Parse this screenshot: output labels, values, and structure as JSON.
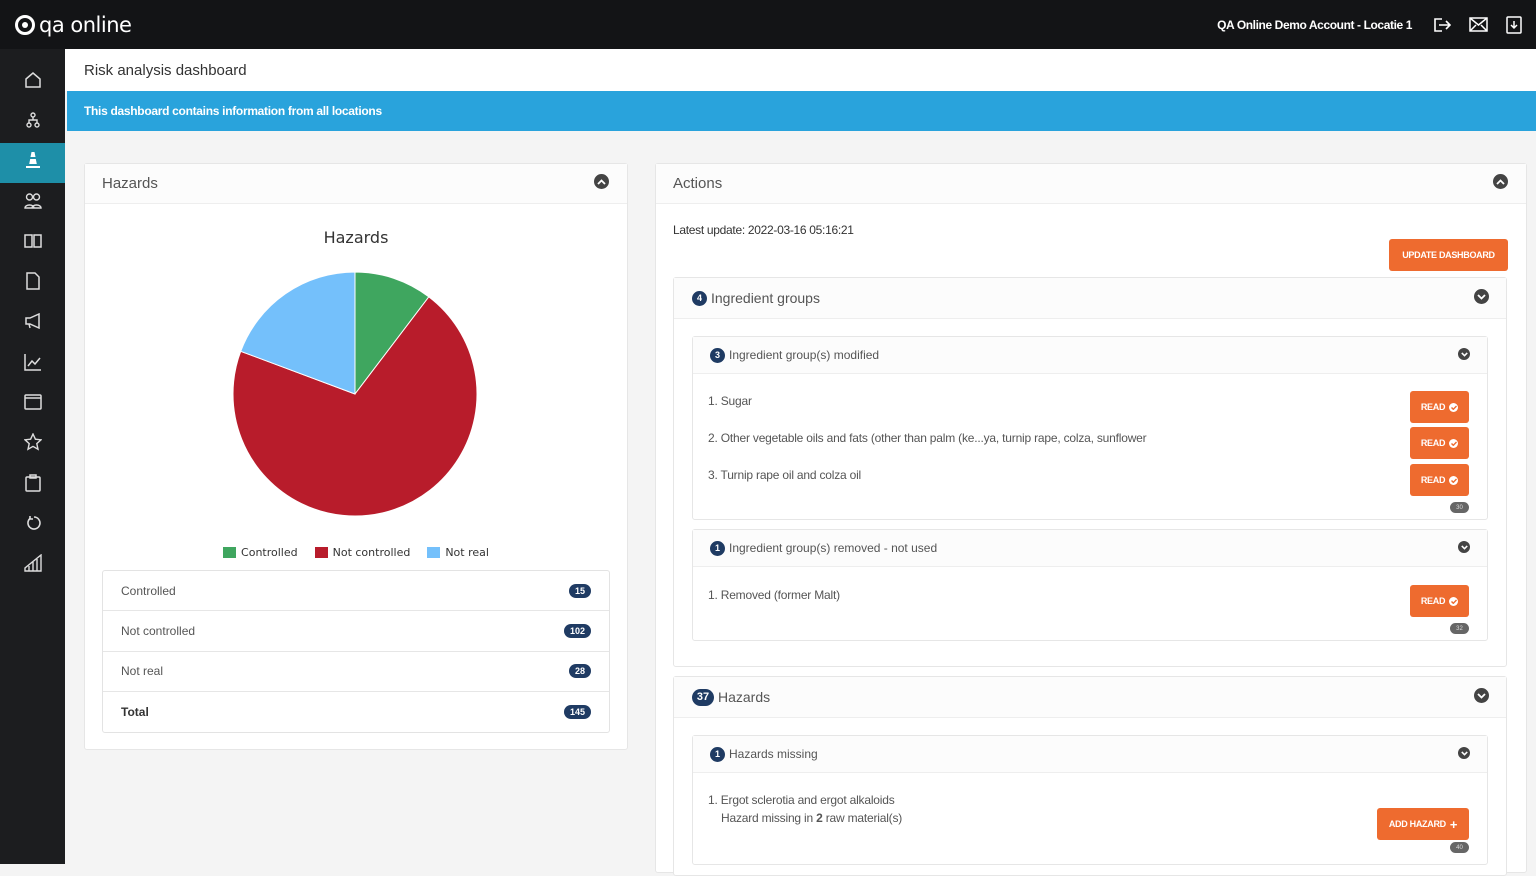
{
  "app": {
    "logo_text": "qa online",
    "account": "QA Online Demo Account - Locatie 1"
  },
  "topbar_icons": [
    "logout-icon",
    "mail-icon",
    "download-icon"
  ],
  "sidebar": {
    "items": [
      {
        "icon": "home-icon",
        "active": false
      },
      {
        "icon": "org-chart-icon",
        "active": false
      },
      {
        "icon": "cone-icon",
        "active": true
      },
      {
        "icon": "users-icon",
        "active": false
      },
      {
        "icon": "book-icon",
        "active": false
      },
      {
        "icon": "document-icon",
        "active": false
      },
      {
        "icon": "megaphone-icon",
        "active": false
      },
      {
        "icon": "chart-line-icon",
        "active": false
      },
      {
        "icon": "window-icon",
        "active": false
      },
      {
        "icon": "star-icon",
        "active": false
      },
      {
        "icon": "clipboard-icon",
        "active": false
      },
      {
        "icon": "refresh-icon",
        "active": false
      },
      {
        "icon": "bar-chart-icon",
        "active": false
      }
    ]
  },
  "page": {
    "title": "Risk analysis dashboard",
    "banner": "This dashboard contains information from all locations"
  },
  "hazards_panel": {
    "title": "Hazards",
    "rows": [
      {
        "label": "Controlled",
        "count": "15"
      },
      {
        "label": "Not controlled",
        "count": "102"
      },
      {
        "label": "Not real",
        "count": "28"
      },
      {
        "label": "Total",
        "count": "145"
      }
    ]
  },
  "chart_data": {
    "type": "pie",
    "title": "Hazards",
    "categories": [
      "Controlled",
      "Not controlled",
      "Not real"
    ],
    "values": [
      15,
      102,
      28
    ],
    "colors": [
      "#3fa65f",
      "#b81c2b",
      "#74c0fb"
    ],
    "legend": "bottom"
  },
  "actions_panel": {
    "title": "Actions",
    "latest_update": "Latest update: 2022-03-16 05:16:21",
    "update_button": "UPDATE DASHBOARD",
    "ingredient_groups": {
      "count": "4",
      "title": "Ingredient groups",
      "modified": {
        "count": "3",
        "title": "Ingredient group(s) modified",
        "items": [
          "1. Sugar",
          "2. Other vegetable oils and fats (other than palm (ke...ya, turnip rape, colza, sunflower",
          "3. Turnip rape oil and colza oil"
        ],
        "button": "READ",
        "small_badge": "30"
      },
      "removed": {
        "count": "1",
        "title": "Ingredient group(s) removed - not used",
        "items": [
          "1. Removed (former Malt)"
        ],
        "button": "READ",
        "small_badge": "32"
      }
    },
    "hazards": {
      "count": "37",
      "title": "Hazards",
      "missing": {
        "count": "1",
        "title": "Hazards missing",
        "item": "1. Ergot sclerotia and ergot alkaloids",
        "detail_prefix": "Hazard missing in ",
        "detail_count": "2",
        "detail_suffix": " raw material(s)",
        "button": "ADD HAZARD",
        "small_badge": "40"
      }
    }
  }
}
